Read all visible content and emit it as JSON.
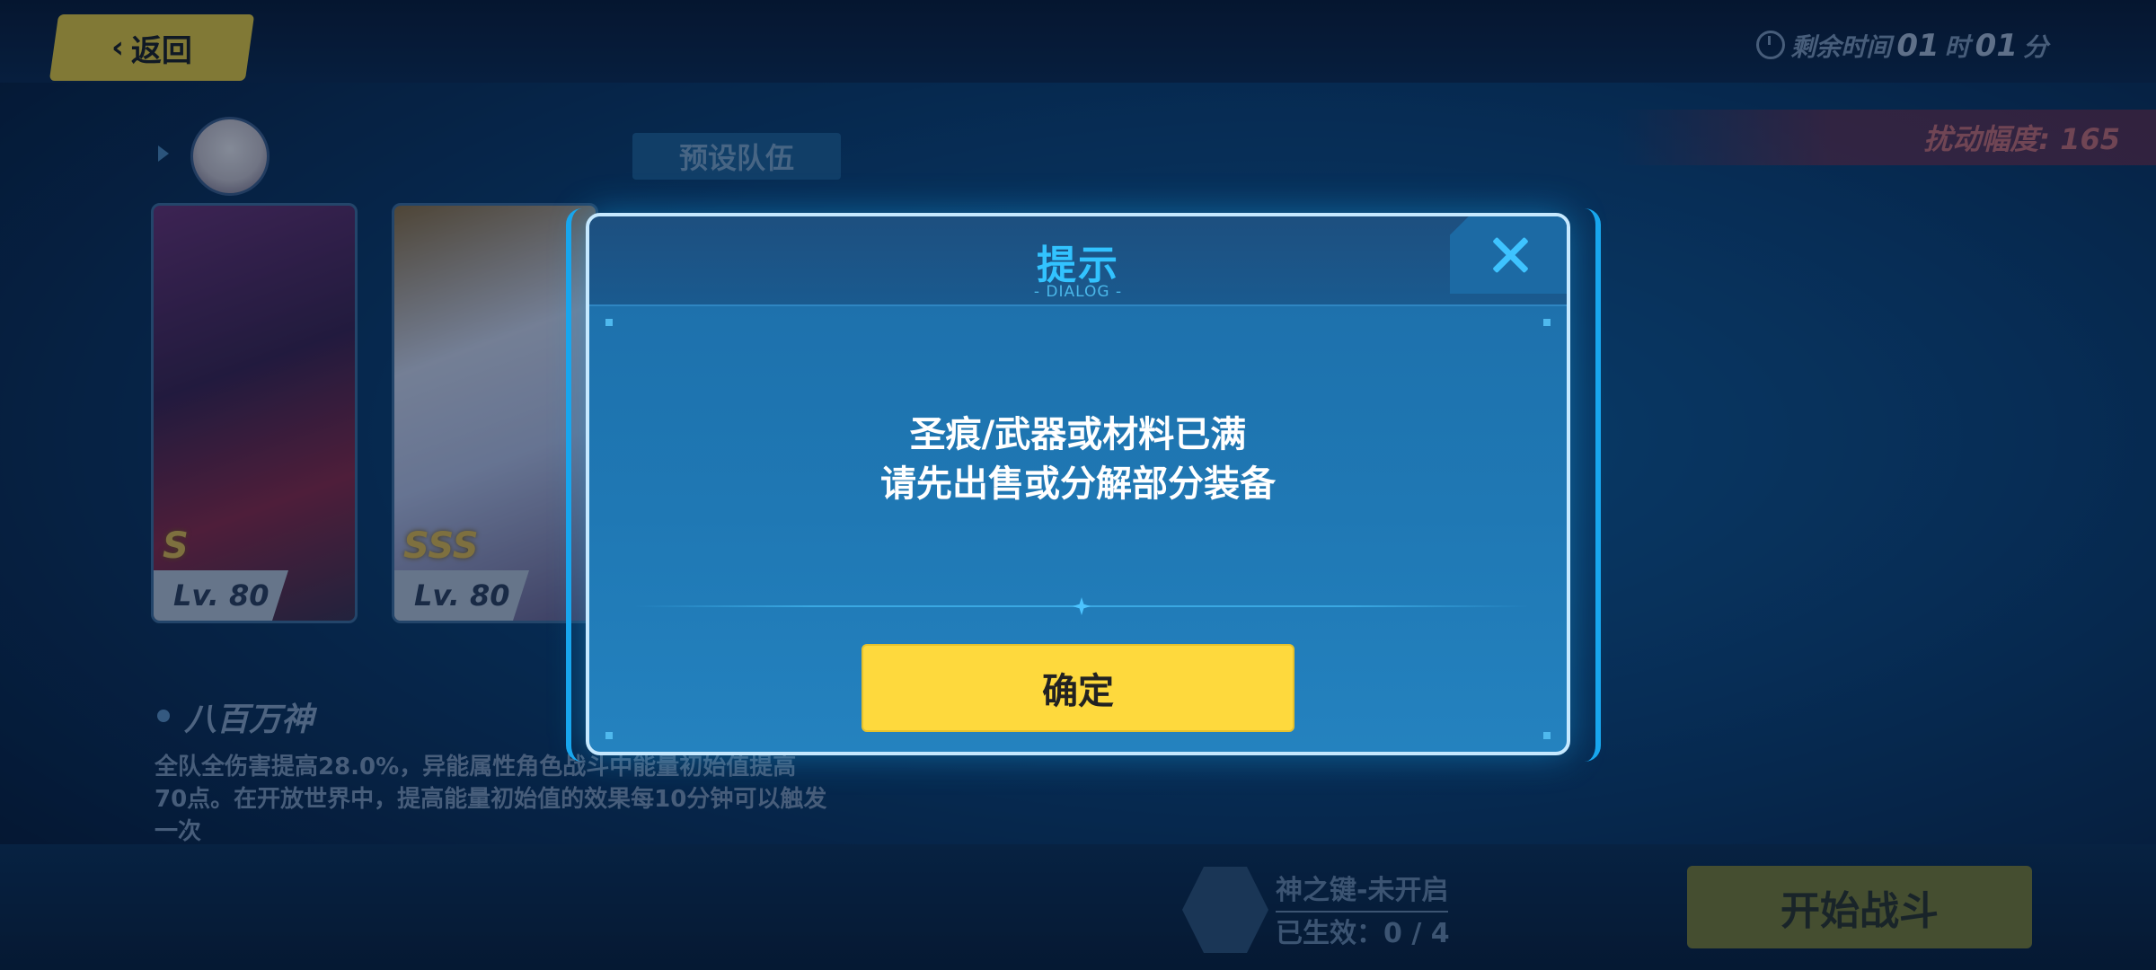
{
  "topbar": {
    "back_label": "返回",
    "time": {
      "prefix": "剩余时间",
      "hours": "01",
      "hours_unit": "时",
      "minutes": "01",
      "minutes_unit": "分"
    }
  },
  "disturbance_label": "扰动幅度: 165",
  "preset_team_label": "预设队伍",
  "characters": [
    {
      "rank": "S",
      "level": "Lv. 80"
    },
    {
      "rank": "SSS",
      "level": "Lv. 80"
    }
  ],
  "buff": {
    "title": "八百万神",
    "description": "全队全伤害提高28.0%，异能属性角色战斗中能量初始值提高70点。在开放世界中，提高能量初始值的效果每10分钟可以触发一次"
  },
  "key": {
    "title": "神之键-未开启",
    "active": "已生效：0 / 4"
  },
  "start_battle_label": "开始战斗",
  "dialog": {
    "title": "提示",
    "subtitle": "- DIALOG -",
    "message_line1": "圣痕/武器或材料已满",
    "message_line2": "请先出售或分解部分装备",
    "confirm_label": "确定"
  },
  "colors": {
    "accent_yellow": "#fed93d",
    "dialog_title_blue": "#32c3ff",
    "dialog_frame": "#19a7ee"
  }
}
